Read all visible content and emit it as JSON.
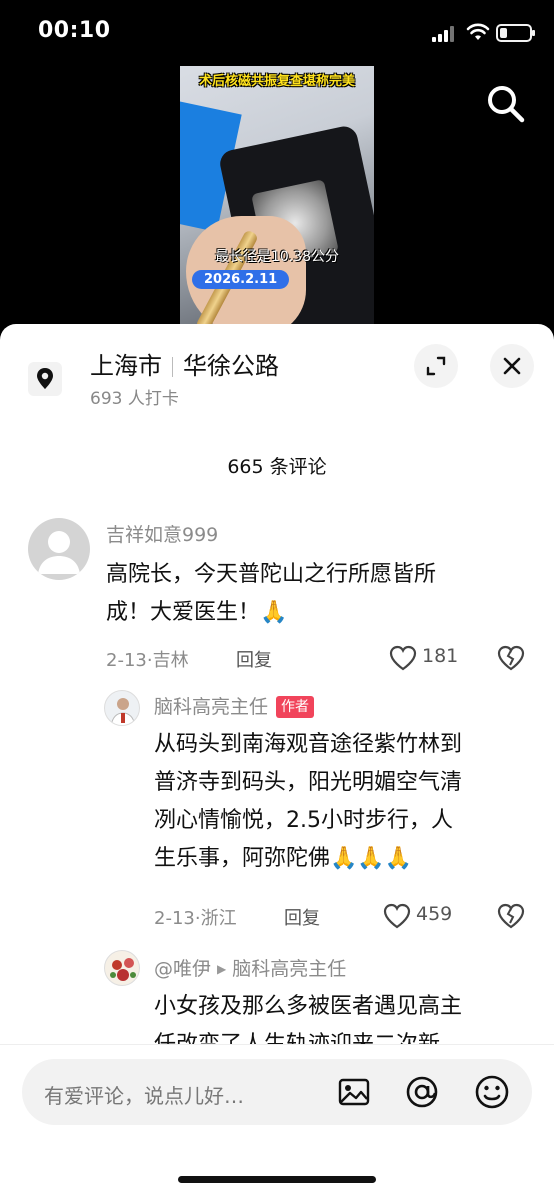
{
  "status_bar": {
    "time": "00:10"
  },
  "video": {
    "caption_top": "术后核磁共振复查堪称完美",
    "caption_sub": "最长径是10.38公分",
    "date_badge": "2026.2.11"
  },
  "location": {
    "city": "上海市",
    "road": "华徐公路",
    "checkins": "693 人打卡"
  },
  "comments_header": {
    "count_label": "665 条评论"
  },
  "comments": [
    {
      "user": "吉祥如意999",
      "text_line1": "高院长，今天普陀山之行所愿皆所",
      "text_line2": "成！大爱医生！🙏",
      "meta": "2-13·吉林",
      "reply_label": "回复",
      "likes": "181"
    },
    {
      "user": "脑科高亮主任",
      "author_tag": "作者",
      "text_line1": "从码头到南海观音途径紫竹林到",
      "text_line2": "普济寺到码头，阳光明媚空气清",
      "text_line3": "冽心情愉悦，2.5小时步行，人",
      "text_line4": "生乐事，阿弥陀佛🙏🙏🙏",
      "meta": "2-13·浙江",
      "reply_label": "回复",
      "likes": "459"
    },
    {
      "user": "@唯伊",
      "reply_to": "脑科高亮主任",
      "text_line1": "小女孩及那么多被医者遇见高主",
      "text_line2": "任改变了人生轨迹迎来二次新"
    }
  ],
  "input_bar": {
    "placeholder": "有爱评论，说点儿好…"
  }
}
